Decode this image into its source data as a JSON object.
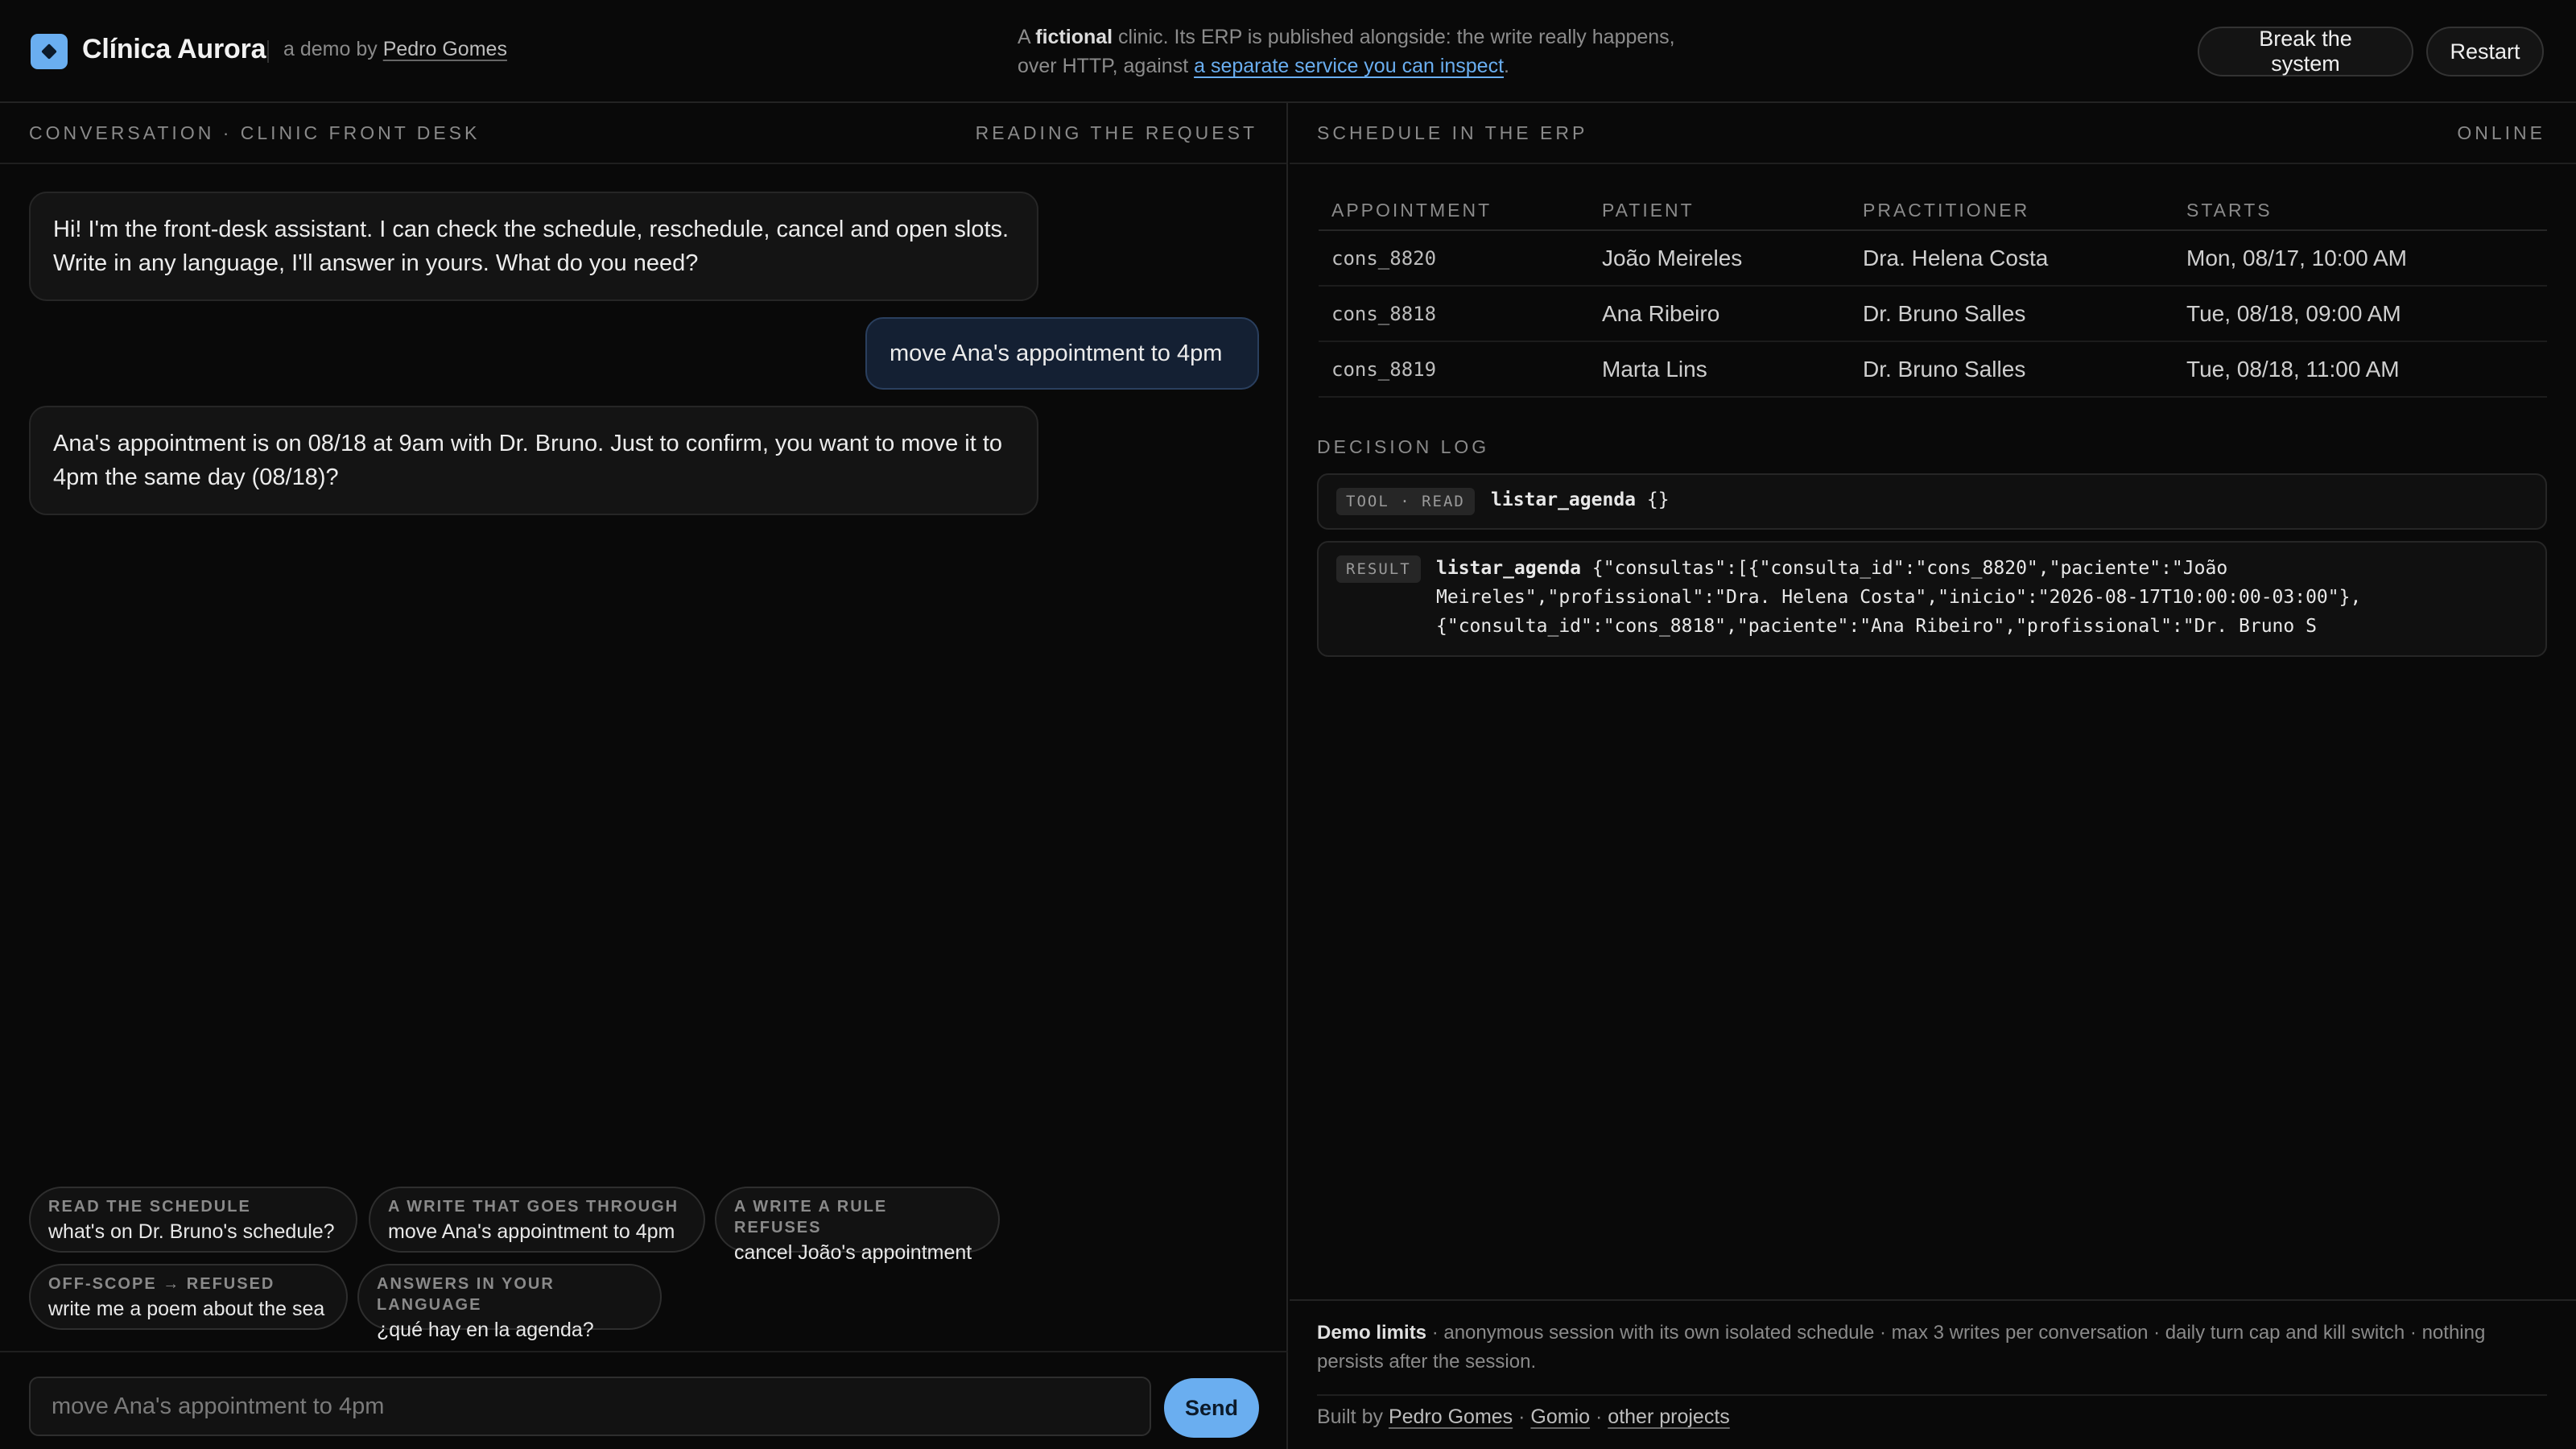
{
  "header": {
    "brand": "Clínica Aurora",
    "byline_prefix": "a demo by",
    "author": "Pedro Gomes",
    "note_a": "A",
    "note_bold": "fictional",
    "note_b": "clinic. Its ERP is published alongside: the write really happens,",
    "note_c": "over HTTP, against",
    "note_link": "a separate service you can inspect",
    "note_end": ".",
    "break_label": "Break the system",
    "restart_label": "Restart"
  },
  "conversation": {
    "title": "CONVERSATION · CLINIC FRONT DESK",
    "status": "READING THE REQUEST",
    "messages": [
      {
        "role": "assistant",
        "text": "Hi! I'm the front-desk assistant. I can check the schedule, reschedule, cancel and open slots. Write in any language, I'll answer in yours. What do you need?"
      },
      {
        "role": "user",
        "text": "move Ana's appointment to 4pm"
      },
      {
        "role": "assistant",
        "text": "Ana's appointment is on 08/18 at 9am with Dr. Bruno. Just to confirm, you want to move it to 4pm the same day (08/18)?"
      }
    ],
    "suggestions": [
      {
        "kind": "READ THE SCHEDULE",
        "text": "what's on Dr. Bruno's schedule?"
      },
      {
        "kind": "A WRITE THAT GOES THROUGH",
        "text": "move Ana's appointment to 4pm"
      },
      {
        "kind": "A WRITE A RULE REFUSES",
        "text": "cancel João's appointment"
      },
      {
        "kind": "OFF-SCOPE → REFUSED",
        "text": "write me a poem about the sea"
      },
      {
        "kind": "ANSWERS IN YOUR LANGUAGE",
        "text": "¿qué hay en la agenda?"
      }
    ],
    "input_placeholder": "move Ana's appointment to 4pm",
    "send_label": "Send"
  },
  "erp": {
    "title": "SCHEDULE IN THE ERP",
    "status": "ONLINE",
    "columns": [
      "APPOINTMENT",
      "PATIENT",
      "PRACTITIONER",
      "STARTS"
    ],
    "rows": [
      {
        "id": "cons_8820",
        "patient": "João Meireles",
        "practitioner": "Dra. Helena Costa",
        "starts": "Mon, 08/17, 10:00 AM"
      },
      {
        "id": "cons_8818",
        "patient": "Ana Ribeiro",
        "practitioner": "Dr. Bruno Salles",
        "starts": "Tue, 08/18, 09:00 AM"
      },
      {
        "id": "cons_8819",
        "patient": "Marta Lins",
        "practitioner": "Dr. Bruno Salles",
        "starts": "Tue, 08/18, 11:00 AM"
      }
    ],
    "log_title": "DECISION LOG",
    "log": [
      {
        "tag": "TOOL · READ",
        "name": "listar_agenda",
        "args": "{}"
      },
      {
        "tag": "RESULT",
        "name": "listar_agenda",
        "line1": "{\"consultas\":[{\"consulta_id\":\"cons_8820\",\"paciente\":\"João",
        "line2": "Meireles\",\"profissional\":\"Dra. Helena Costa\",\"inicio\":\"2026-08-17T10:00:00-03:00\"},",
        "line3": "{\"consulta_id\":\"cons_8818\",\"paciente\":\"Ana Ribeiro\",\"profissional\":\"Dr. Bruno S"
      }
    ]
  },
  "footer": {
    "limits_label": "Demo limits",
    "limits_text": "· anonymous session with its own isolated schedule · max 3 writes per conversation · daily turn cap and kill switch · nothing persists after the session.",
    "built_by": "Built by",
    "link_author": "Pedro Gomes",
    "sep": "·",
    "link_gomio": "Gomio",
    "link_other": "other projects"
  },
  "colors": {
    "accent": "#6aaef0",
    "background": "#090909",
    "user_bubble": "#142033"
  }
}
